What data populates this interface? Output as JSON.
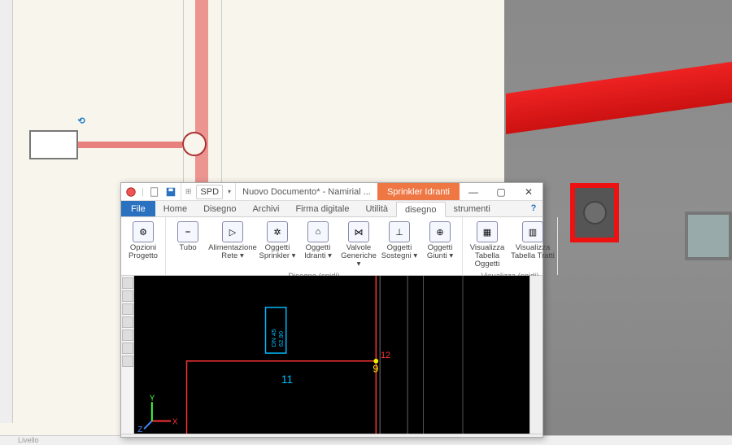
{
  "bg": {
    "bottom_status": "Livello",
    "rotate_glyph": "⟲"
  },
  "win": {
    "qa_spd": "SPD",
    "title": "Nuovo Documento* - Namirial ...",
    "context_tab": "Sprinkler Idranti",
    "controls": {
      "min": "—",
      "max": "▢",
      "close": "✕"
    }
  },
  "menu": {
    "file": "File",
    "tabs": [
      "Home",
      "Disegno",
      "Archivi",
      "Firma digitale",
      "Utilità"
    ],
    "subtabs": [
      "disegno",
      "strumenti"
    ],
    "active_sub": "disegno",
    "help": "?"
  },
  "ribbon": {
    "groups": [
      {
        "label": "",
        "items": [
          {
            "name": "opzioni-progetto",
            "icon": "⚙",
            "label": "Opzioni Progetto"
          }
        ]
      },
      {
        "label": "Disegno (spidi)",
        "items": [
          {
            "name": "tubo",
            "icon": "⎯",
            "label": "Tubo"
          },
          {
            "name": "alimentazione-rete",
            "icon": "▷",
            "label": "Alimentazione Rete ▾"
          },
          {
            "name": "oggetti-sprinkler",
            "icon": "✲",
            "label": "Oggetti Sprinkler ▾"
          },
          {
            "name": "oggetti-idranti",
            "icon": "⌂",
            "label": "Oggetti Idranti ▾"
          },
          {
            "name": "valvole-generiche",
            "icon": "⋈",
            "label": "Valvole Generiche ▾"
          },
          {
            "name": "oggetti-sostegni",
            "icon": "⊥",
            "label": "Oggetti Sostegni ▾"
          },
          {
            "name": "oggetti-giunti",
            "icon": "⊕",
            "label": "Oggetti Giunti ▾"
          }
        ]
      },
      {
        "label": "Visualizza (spidi)",
        "items": [
          {
            "name": "visualizza-tabella-oggetti",
            "icon": "▦",
            "label": "Visualizza Tabella Oggetti"
          },
          {
            "name": "visualizza-tabella-tratti",
            "icon": "▥",
            "label": "Visualizza Tabella Tratti"
          }
        ]
      }
    ]
  },
  "cad": {
    "node_labels": {
      "n9": "9",
      "n11": "11",
      "n12": "12"
    },
    "axes": {
      "x": "X",
      "y": "Y",
      "z": "Z"
    },
    "block_text": [
      "DN 45",
      "62.90"
    ]
  }
}
